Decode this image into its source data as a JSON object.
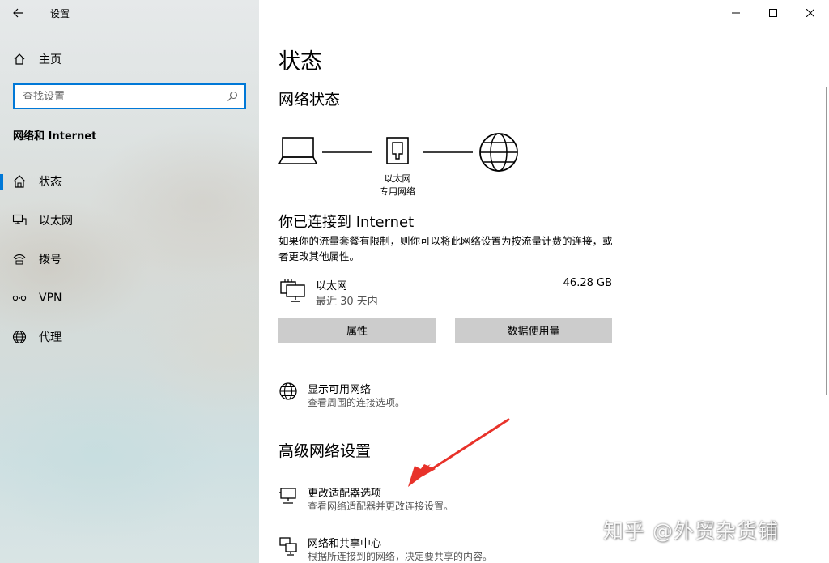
{
  "window": {
    "title": "设置"
  },
  "sidebar": {
    "home_label": "主页",
    "search_placeholder": "查找设置",
    "section_title": "网络和 Internet",
    "items": [
      {
        "label": "状态",
        "icon": "home-status-icon",
        "selected": true
      },
      {
        "label": "以太网",
        "icon": "ethernet-icon",
        "selected": false
      },
      {
        "label": "拨号",
        "icon": "dialup-icon",
        "selected": false
      },
      {
        "label": "VPN",
        "icon": "vpn-icon",
        "selected": false
      },
      {
        "label": "代理",
        "icon": "globe-icon",
        "selected": false
      }
    ]
  },
  "main": {
    "page_title": "状态",
    "network_status_heading": "网络状态",
    "diagram": {
      "adapter_label": "以太网",
      "adapter_sublabel": "专用网络"
    },
    "connected_title": "你已连接到 Internet",
    "connected_desc": "如果你的流量套餐有限制，则你可以将此网络设置为按流量计费的连接，或者更改其他属性。",
    "connection": {
      "name": "以太网",
      "period": "最近 30 天内",
      "usage": "46.28 GB"
    },
    "buttons": {
      "properties": "属性",
      "data_usage": "数据使用量"
    },
    "show_networks": {
      "title": "显示可用网络",
      "desc": "查看周围的连接选项。"
    },
    "advanced_heading": "高级网络设置",
    "adapter_options": {
      "title": "更改适配器选项",
      "desc": "查看网络适配器并更改连接设置。"
    },
    "sharing_center": {
      "title": "网络和共享中心",
      "desc": "根据所连接到的网络，决定要共享的内容。"
    }
  },
  "watermark": "知乎 @外贸杂货铺",
  "colors": {
    "accent": "#0078d7",
    "button_bg": "#cccccc",
    "annotation_arrow": "#e8322a"
  }
}
